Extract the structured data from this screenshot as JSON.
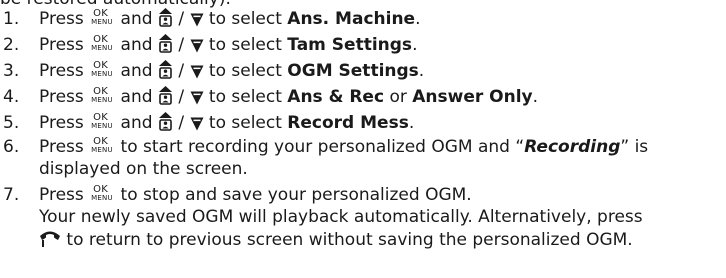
{
  "top_fragment": "be restored automatically).",
  "icons": {
    "ok_top": "OK",
    "ok_bottom": "MENU"
  },
  "steps": [
    {
      "num": "1.",
      "prefix": "Press ",
      "mid": " and ",
      "slash": " / ",
      "to": " to select ",
      "bold": "Ans. Machine",
      "tail": "."
    },
    {
      "num": "2.",
      "prefix": "Press ",
      "mid": " and ",
      "slash": " / ",
      "to": " to select ",
      "bold": "Tam Settings",
      "tail": "."
    },
    {
      "num": "3.",
      "prefix": "Press ",
      "mid": " and ",
      "slash": " / ",
      "to": " to select ",
      "bold": "OGM Settings",
      "tail": "."
    },
    {
      "num": "4.",
      "prefix": "Press ",
      "mid": " and ",
      "slash": " / ",
      "to": " to select ",
      "bold": "Ans & Rec",
      "or": " or ",
      "bold2": "Answer Only",
      "tail": "."
    },
    {
      "num": "5.",
      "prefix": "Press ",
      "mid": " and ",
      "slash": " / ",
      "to": " to select ",
      "bold": "Record Mess",
      "tail": "."
    }
  ],
  "step6": {
    "num": "6.",
    "prefix": "Press ",
    "text1": " to start recording your personalized OGM and “",
    "bolditalic": "Recording",
    "text2": "” is",
    "line2": "displayed on the screen."
  },
  "step7": {
    "num": "7.",
    "prefix": "Press ",
    "text1": " to stop and save your personalized OGM.",
    "line2": "Your newly saved OGM will playback automatically. Alternatively, press",
    "line3": " to return to previous screen without saving the personalized OGM."
  }
}
